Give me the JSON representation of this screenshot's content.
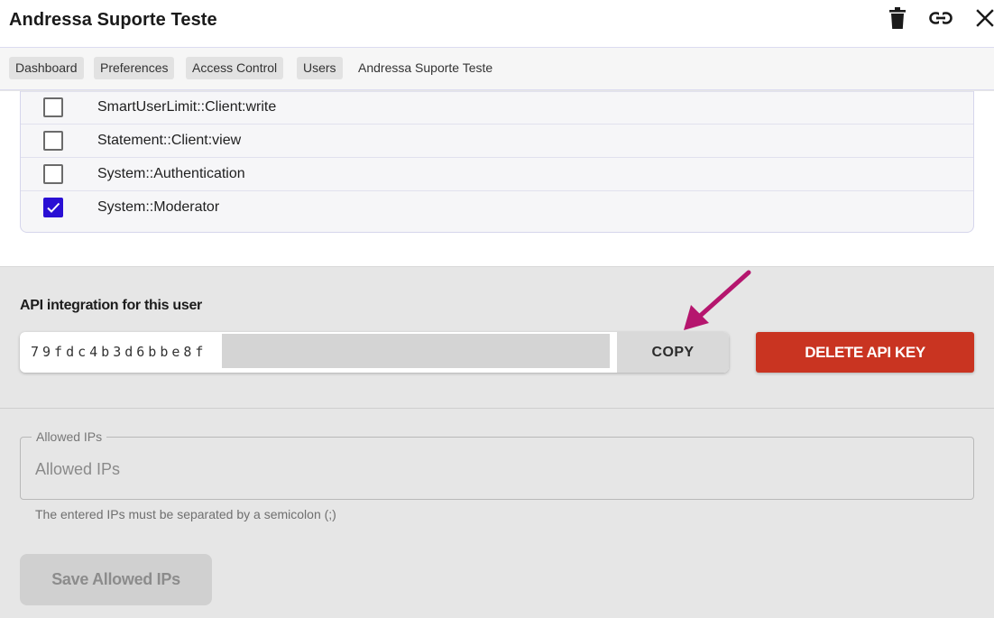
{
  "header": {
    "title": "Andressa Suporte Teste",
    "icons": [
      "trash-icon",
      "link-icon",
      "close-icon"
    ]
  },
  "breadcrumb": {
    "items": [
      "Dashboard",
      "Preferences",
      "Access Control",
      "Users"
    ],
    "current": "Andressa Suporte Teste"
  },
  "permissions": [
    {
      "label": "SmartUserLimit::Client:write",
      "checked": false
    },
    {
      "label": "Statement::Client:view",
      "checked": false
    },
    {
      "label": "System::Authentication",
      "checked": false
    },
    {
      "label": "System::Moderator",
      "checked": true
    }
  ],
  "api": {
    "heading": "API integration for this user",
    "key_visible": "79fdc4b3d6bbe8f",
    "copy_label": "COPY",
    "delete_label": "DELETE API KEY"
  },
  "allowed_ips": {
    "legend": "Allowed IPs",
    "placeholder": "Allowed IPs",
    "value": "",
    "help": "The entered IPs must be separated by a semicolon (;)",
    "save_label": "Save Allowed IPs"
  },
  "colors": {
    "accent_checkbox": "#2a0fd4",
    "danger": "#c93421",
    "annotation_arrow": "#b5166e"
  }
}
